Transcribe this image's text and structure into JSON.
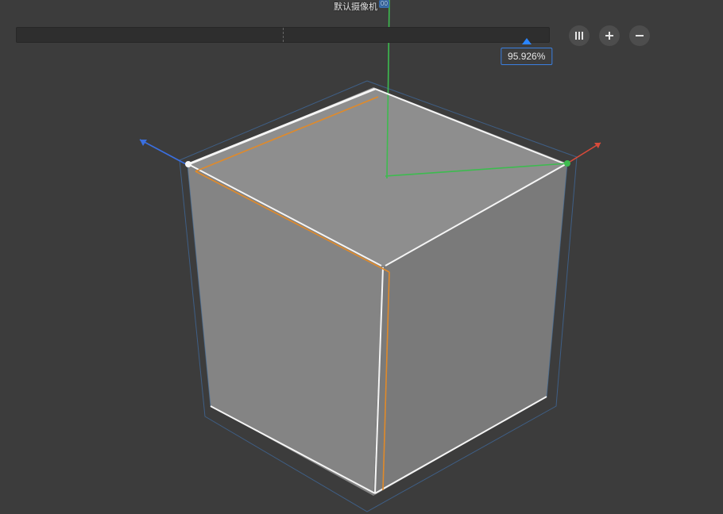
{
  "camera": {
    "label": "默认摄像机",
    "badge": "00"
  },
  "slider": {
    "value_text": "95.926%",
    "percent": 95.926,
    "tick_percent": 50
  },
  "buttons": {
    "columns_title": "columns",
    "plus_title": "add",
    "minus_title": "remove"
  },
  "axes": {
    "x_color": "#d94a3a",
    "y_color": "#3dbb4f",
    "z_color": "#3a6fe0"
  },
  "cube": {
    "face_top": "#8e8e8e",
    "face_left": "#848484",
    "face_right": "#7a7a7a",
    "edge_white": "#f5f5f5",
    "edge_orange": "#e08a2a",
    "edge_blue": "#4a74a0",
    "edge_green": "#3dbb4f",
    "outline_blue": "#3f5f86"
  }
}
